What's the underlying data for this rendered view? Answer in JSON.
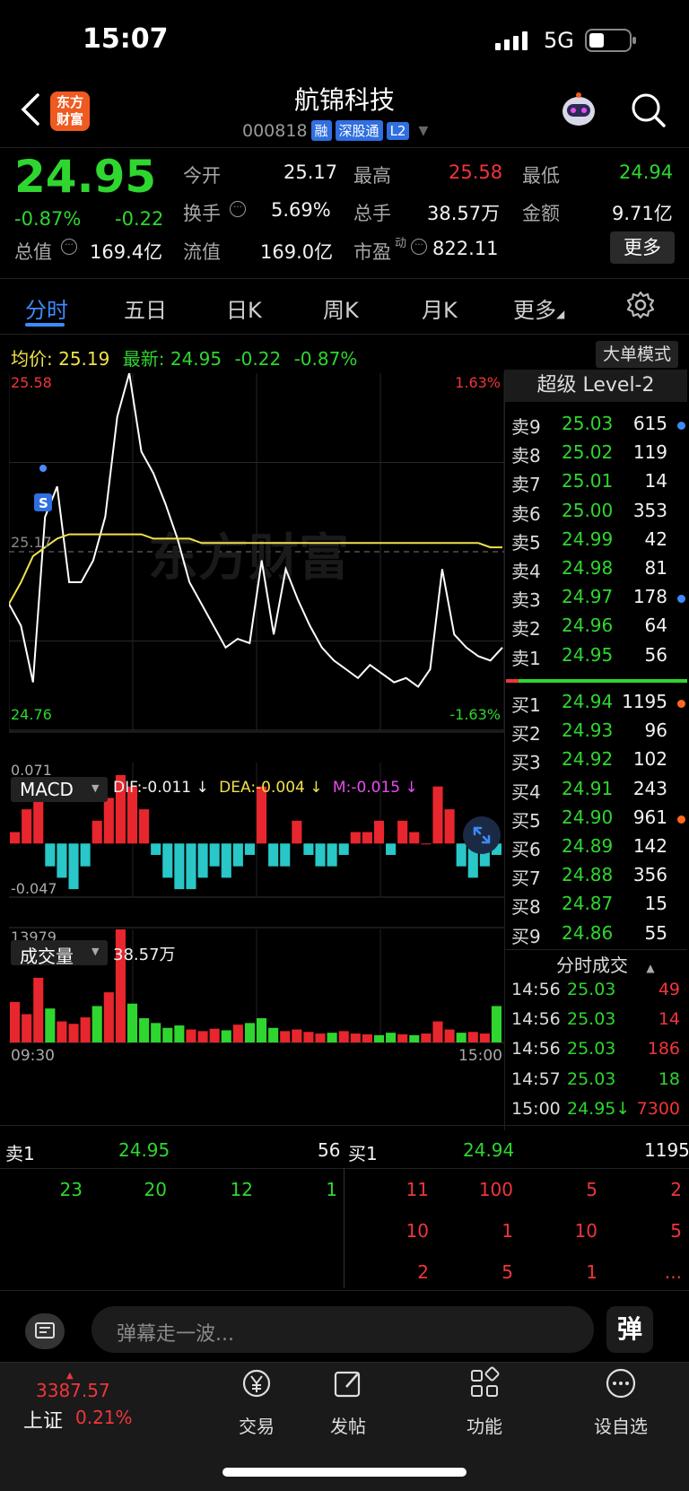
{
  "status": {
    "time": "15:07",
    "network": "5G"
  },
  "header": {
    "logo_lines": [
      "东方",
      "财富"
    ],
    "title": "航锦科技",
    "code": "000818",
    "tags": [
      "融",
      "深股通",
      "L2"
    ]
  },
  "quote": {
    "price": "24.95",
    "change_pct": "-0.87%",
    "change": "-0.22",
    "stats": [
      {
        "label": "今开",
        "value": "25.17",
        "color": "#f2f2f2"
      },
      {
        "label": "最高",
        "value": "25.58",
        "color": "#f0353b"
      },
      {
        "label": "最低",
        "value": "24.94",
        "color": "#2fd62f"
      },
      {
        "label": "换手",
        "value": "5.69%",
        "color": "#f2f2f2"
      },
      {
        "label": "总手",
        "value": "38.57万",
        "color": "#f2f2f2"
      },
      {
        "label": "金额",
        "value": "9.71亿",
        "color": "#f2f2f2"
      },
      {
        "label": "总值",
        "value": "169.4亿",
        "color": "#f2f2f2"
      },
      {
        "label": "流值",
        "value": "169.0亿",
        "color": "#f2f2f2"
      },
      {
        "label": "市盈",
        "value": "822.11",
        "color": "#f2f2f2"
      }
    ],
    "pe_superscript": "动",
    "more_label": "更多"
  },
  "tabs": [
    "分时",
    "五日",
    "日K",
    "周K",
    "月K",
    "更多"
  ],
  "avg_row": {
    "avg_label": "均价:",
    "avg_value": "25.19",
    "latest_label": "最新:",
    "latest_value": "24.95",
    "change": "-0.22",
    "change_pct": "-0.87%"
  },
  "big_order_mode": "大单模式",
  "chart_data": [
    {
      "type": "line",
      "name": "分时",
      "y_labels": {
        "top": "25.58",
        "bottom": "24.76",
        "top_pct": "1.63%",
        "bottom_pct": "-1.63%",
        "mid": "25.17"
      },
      "ylim": [
        24.76,
        25.58
      ],
      "x_labels": [
        "09:30",
        "15:00"
      ],
      "watermark": "东方财富",
      "series": [
        {
          "values": [
            25.05,
            25.0,
            24.87,
            25.25,
            25.32,
            25.1,
            25.1,
            25.15,
            25.25,
            25.48,
            25.58,
            25.4,
            25.35,
            25.28,
            25.2,
            25.1,
            25.05,
            25.0,
            24.95,
            24.97,
            24.96,
            25.15,
            24.98,
            25.13,
            25.06,
            25.0,
            24.95,
            24.92,
            24.9,
            24.88,
            24.91,
            24.89,
            24.87,
            24.88,
            24.86,
            24.9,
            25.13,
            24.98,
            24.95,
            24.93,
            24.92,
            24.95
          ]
        },
        {
          "values": [
            25.05,
            25.1,
            25.16,
            25.18,
            25.2,
            25.21,
            25.21,
            25.21,
            25.21,
            25.21,
            25.21,
            25.21,
            25.2,
            25.2,
            25.2,
            25.2,
            25.19,
            25.19,
            25.19,
            25.19,
            25.19,
            25.19,
            25.19,
            25.19,
            25.19,
            25.19,
            25.19,
            25.19,
            25.19,
            25.19,
            25.19,
            25.19,
            25.19,
            25.19,
            25.19,
            25.19,
            25.19,
            25.19,
            25.19,
            25.19,
            25.18,
            25.18
          ]
        }
      ]
    },
    {
      "type": "bar",
      "name": "MACD",
      "labels": {
        "title": "MACD",
        "dif": "DIF:-0.011",
        "dea": "DEA:-0.004",
        "m": "M:-0.015",
        "top": "0.071",
        "bottom": "-0.047"
      },
      "ylim": [
        -0.047,
        0.071
      ],
      "values": [
        0.01,
        0.03,
        0.05,
        -0.02,
        -0.03,
        -0.04,
        -0.02,
        0.02,
        0.04,
        0.06,
        0.05,
        0.03,
        -0.01,
        -0.03,
        -0.04,
        -0.04,
        -0.03,
        -0.02,
        -0.03,
        -0.02,
        -0.01,
        0.05,
        -0.02,
        -0.02,
        0.02,
        -0.01,
        -0.02,
        -0.02,
        -0.01,
        0.01,
        0.01,
        0.02,
        -0.01,
        0.02,
        0.01,
        0.0,
        0.05,
        0.03,
        -0.02,
        -0.03,
        -0.02,
        -0.01
      ]
    },
    {
      "type": "bar",
      "name": "成交量",
      "labels": {
        "title": "成交量",
        "total": "38.57万",
        "max": "13979"
      },
      "ylim": [
        0,
        13979
      ],
      "values": [
        5000,
        3500,
        8000,
        4200,
        2600,
        2300,
        3100,
        4500,
        6200,
        13979,
        4800,
        3000,
        2400,
        1800,
        2100,
        1600,
        1400,
        1700,
        1500,
        2200,
        2400,
        3000,
        1800,
        1400,
        1600,
        1300,
        1100,
        1200,
        1400,
        1100,
        1000,
        900,
        1200,
        1000,
        900,
        1100,
        2600,
        1600,
        1200,
        1300,
        1100,
        4500
      ]
    }
  ],
  "order_book": {
    "title": "超级 Level-2",
    "asks": [
      {
        "label": "卖9",
        "price": "25.03",
        "vol": "615",
        "dot": "#3d8bff"
      },
      {
        "label": "卖8",
        "price": "25.02",
        "vol": "119",
        "dot": ""
      },
      {
        "label": "卖7",
        "price": "25.01",
        "vol": "14",
        "dot": ""
      },
      {
        "label": "卖6",
        "price": "25.00",
        "vol": "353",
        "dot": ""
      },
      {
        "label": "卖5",
        "price": "24.99",
        "vol": "42",
        "dot": ""
      },
      {
        "label": "卖4",
        "price": "24.98",
        "vol": "81",
        "dot": ""
      },
      {
        "label": "卖3",
        "price": "24.97",
        "vol": "178",
        "dot": "#3d8bff"
      },
      {
        "label": "卖2",
        "price": "24.96",
        "vol": "64",
        "dot": ""
      },
      {
        "label": "卖1",
        "price": "24.95",
        "vol": "56",
        "dot": ""
      }
    ],
    "bids": [
      {
        "label": "买1",
        "price": "24.94",
        "vol": "1195",
        "dot": "#ff6a1a"
      },
      {
        "label": "买2",
        "price": "24.93",
        "vol": "96",
        "dot": ""
      },
      {
        "label": "买3",
        "price": "24.92",
        "vol": "102",
        "dot": ""
      },
      {
        "label": "买4",
        "price": "24.91",
        "vol": "243",
        "dot": ""
      },
      {
        "label": "买5",
        "price": "24.90",
        "vol": "961",
        "dot": "#ff6a1a"
      },
      {
        "label": "买6",
        "price": "24.89",
        "vol": "142",
        "dot": ""
      },
      {
        "label": "买7",
        "price": "24.88",
        "vol": "356",
        "dot": ""
      },
      {
        "label": "买8",
        "price": "24.87",
        "vol": "15",
        "dot": ""
      },
      {
        "label": "买9",
        "price": "24.86",
        "vol": "55",
        "dot": ""
      }
    ]
  },
  "trades": {
    "title": "分时成交",
    "rows": [
      {
        "time": "14:56",
        "price": "25.03",
        "vol": "49",
        "vol_color": "#f0353b"
      },
      {
        "time": "14:56",
        "price": "25.03",
        "vol": "14",
        "vol_color": "#f0353b"
      },
      {
        "time": "14:56",
        "price": "25.03",
        "vol": "186",
        "vol_color": "#f0353b"
      },
      {
        "time": "14:57",
        "price": "25.03",
        "vol": "18",
        "vol_color": "#2fd62f"
      },
      {
        "time": "15:00",
        "price": "24.95↓",
        "vol": "7300",
        "vol_color": "#f0353b"
      }
    ]
  },
  "queue": {
    "sell": {
      "label": "卖1",
      "price": "24.95",
      "vol": "56",
      "orders": [
        "23",
        "20",
        "12",
        "1"
      ]
    },
    "buy": {
      "label": "买1",
      "price": "24.94",
      "vol": "1195",
      "orders": [
        [
          "11",
          "100",
          "5",
          "2"
        ],
        [
          "10",
          "1",
          "10",
          "5"
        ],
        [
          "2",
          "5",
          "1",
          "..."
        ]
      ]
    }
  },
  "comment": {
    "placeholder": "弹幕走一波...",
    "danmu_glyph": "弹"
  },
  "nav": {
    "index_value": "3387.57",
    "index_name": "上证",
    "index_pct": "0.21%",
    "items": [
      "交易",
      "发帖",
      "功能",
      "设自选"
    ]
  }
}
